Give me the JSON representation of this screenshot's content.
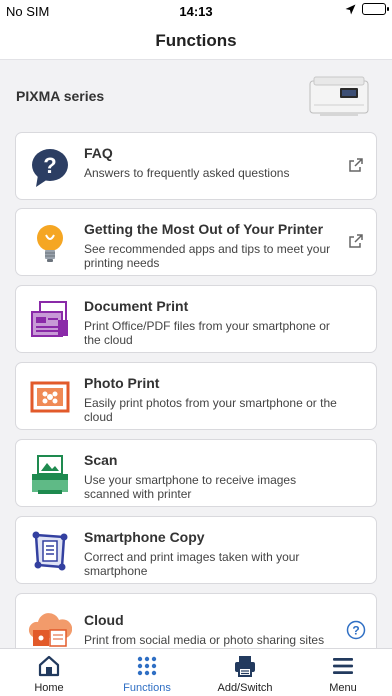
{
  "status": {
    "carrier": "No SIM",
    "time": "14:13"
  },
  "header": {
    "title": "Functions"
  },
  "printer": {
    "name": "PIXMA series"
  },
  "cards": [
    {
      "title": "FAQ",
      "desc": "Answers to frequently asked questions",
      "icon": "faq-icon",
      "trailing": "external-link-icon"
    },
    {
      "title": "Getting the Most Out of Your Printer",
      "desc": "See recommended apps and tips to meet your printing needs",
      "icon": "lightbulb-icon",
      "trailing": "external-link-icon"
    },
    {
      "title": "Document Print",
      "desc": "Print Office/PDF files from your smartphone or the cloud",
      "icon": "document-print-icon"
    },
    {
      "title": "Photo Print",
      "desc": "Easily print photos from your smartphone or the cloud",
      "icon": "photo-print-icon"
    },
    {
      "title": "Scan",
      "desc": "Use your smartphone to receive images scanned with printer",
      "icon": "scan-icon"
    },
    {
      "title": "Smartphone Copy",
      "desc": "Correct and print images taken with your smartphone",
      "icon": "smartphone-copy-icon"
    },
    {
      "title": "Cloud",
      "desc": "Print from social media or photo sharing sites",
      "icon": "cloud-icon",
      "trailing": "help-icon"
    }
  ],
  "tabs": [
    {
      "label": "Home",
      "icon": "home-icon"
    },
    {
      "label": "Functions",
      "icon": "grid-icon",
      "active": true
    },
    {
      "label": "Add/Switch",
      "icon": "printer-icon"
    },
    {
      "label": "Menu",
      "icon": "menu-icon"
    }
  ],
  "colors": {
    "accent": "#2f6fc4",
    "document": "#8a2aa8",
    "photo": "#e25a2a",
    "scan": "#1e8a4f",
    "copy": "#3340a0"
  }
}
